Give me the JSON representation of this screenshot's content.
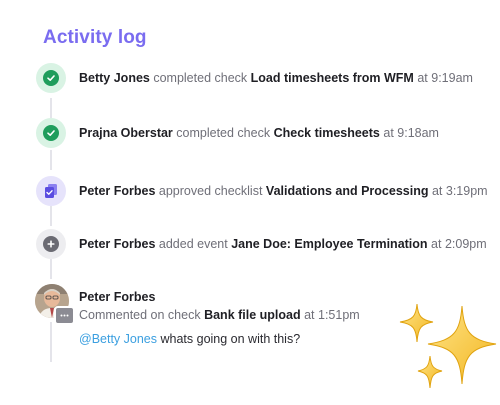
{
  "header": {
    "title": "Activity log"
  },
  "entries": [
    {
      "actor": "Betty Jones",
      "verb": "completed check",
      "object": "Load timesheets from WFM",
      "time": "at 9:19am",
      "icon": "check-icon"
    },
    {
      "actor": "Prajna Oberstar",
      "verb": "completed check",
      "object": "Check timesheets",
      "time": "at 9:18am",
      "icon": "check-icon"
    },
    {
      "actor": "Peter Forbes",
      "verb": "approved checklist",
      "object": "Validations and Processing",
      "time": "at 3:19pm",
      "icon": "checklist-approved-icon"
    },
    {
      "actor": "Peter Forbes",
      "verb": "added event",
      "object": "Jane Doe: Employee Termination",
      "time": "at 2:09pm",
      "icon": "add-event-icon"
    }
  ],
  "comment": {
    "actor": "Peter Forbes",
    "verb": "Commented on check",
    "object": "Bank file upload",
    "time": "at 1:51pm",
    "mention": "@Betty Jones",
    "message": " whats going on with this?",
    "icon": "comment-icon"
  },
  "colors": {
    "title": "#7a6cf0",
    "success": "#1f9d5c",
    "approve": "#6a5ce8",
    "mention": "#3b9fe0",
    "sparkle": "#f6c43a"
  }
}
